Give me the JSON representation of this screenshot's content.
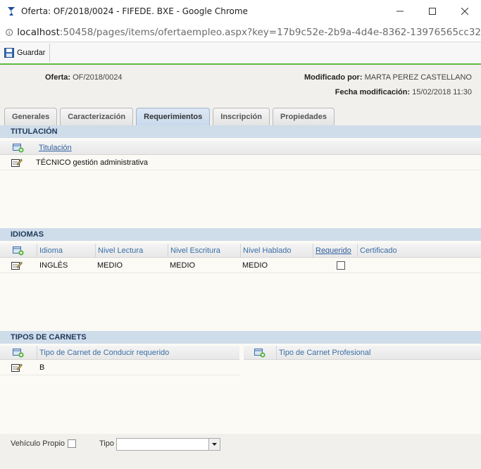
{
  "window": {
    "title": "Oferta: OF/2018/0024 - FIFEDE. BXE - Google Chrome",
    "url_host": "localhost",
    "url_rest": ":50458/pages/items/ofertaempleo.aspx?key=17b9c52e-2b9a-4d4e-8362-13976565cc32"
  },
  "toolbar": {
    "save_label": "Guardar"
  },
  "header": {
    "oferta_label": "Oferta:",
    "oferta_value": "OF/2018/0024",
    "modificado_label": "Modificado por:",
    "modificado_value": "MARTA PEREZ CASTELLANO",
    "fecha_label": "Fecha modificación:",
    "fecha_value": "15/02/2018 11:30"
  },
  "tabs": [
    {
      "label": "Generales"
    },
    {
      "label": "Caracterización"
    },
    {
      "label": "Requerimientos"
    },
    {
      "label": "Inscripción"
    },
    {
      "label": "Propiedades"
    }
  ],
  "titulacion": {
    "section_title": "TITULACIÓN",
    "col_titulacion": "Titulación",
    "rows": [
      {
        "titulacion": "TÉCNICO gestión administrativa"
      }
    ]
  },
  "idiomas": {
    "section_title": "IDIOMAS",
    "cols": {
      "idioma": "Idioma",
      "lectura": "Nivel Lectura",
      "escritura": "Nivel Escritura",
      "hablado": "Nivel Hablado",
      "requerido": "Requerido",
      "certificado": "Certificado"
    },
    "rows": [
      {
        "idioma": "INGLÉS",
        "lectura": "MEDIO",
        "escritura": "MEDIO",
        "hablado": "MEDIO",
        "requerido": false
      }
    ]
  },
  "carnets": {
    "section_title": "TIPOS DE CARNETS",
    "col_conducir": "Tipo de Carnet de Conducir requerido",
    "col_profesional": "Tipo de Carnet Profesional",
    "rows": [
      {
        "conducir": "B"
      }
    ]
  },
  "footer": {
    "vehiculo_label": "Vehículo Propio",
    "tipo_label": "Tipo",
    "tipo_value": ""
  },
  "colors": {
    "accent_green": "#5dbb3f",
    "section_blue": "#cfdcea",
    "link_blue": "#2f5fa0"
  }
}
